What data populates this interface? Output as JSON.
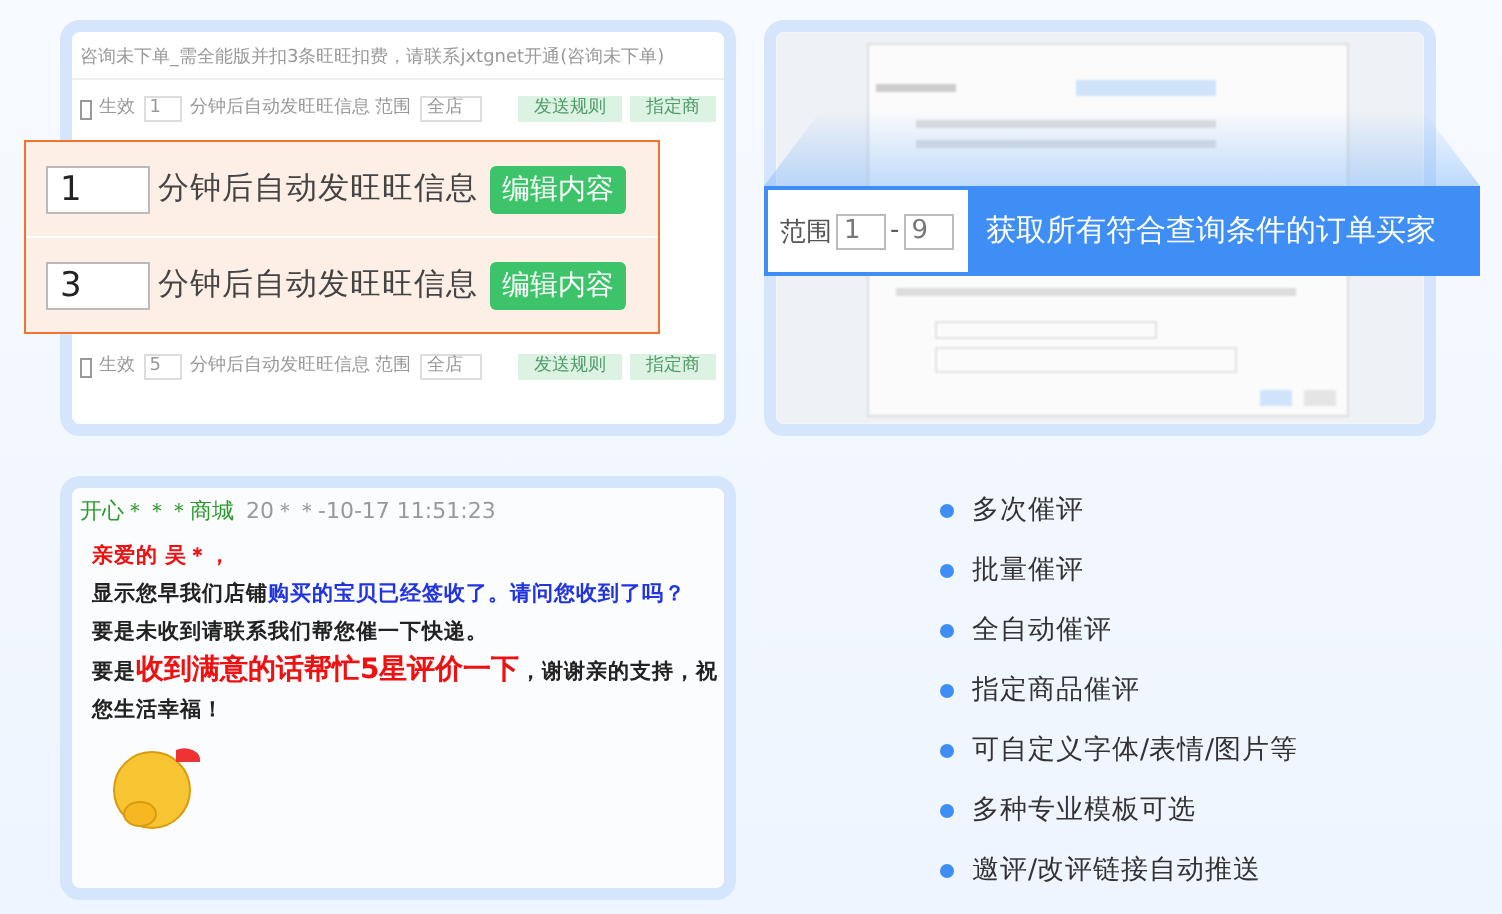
{
  "rule_panel": {
    "header": "咨询未下单_需全能版并扣3条旺旺扣费，请联系jxtgnet开通(咨询未下单)",
    "rows": [
      {
        "checked": false,
        "label": "生效",
        "minutes": "1",
        "text": "分钟后自动发旺旺信息 范围",
        "scope": "全店",
        "buttons": [
          "发送规则",
          "指定商"
        ]
      },
      {
        "checked": false,
        "label": "生效",
        "minutes": "5",
        "text": "分钟后自动发旺旺信息 范围",
        "scope": "全店",
        "buttons": [
          "发送规则",
          "指定商"
        ]
      }
    ]
  },
  "rule_zoom": {
    "rows": [
      {
        "minutes": "1",
        "text": "分钟后自动发旺旺信息",
        "button": "编辑内容"
      },
      {
        "minutes": "3",
        "text": "分钟后自动发旺旺信息",
        "button": "编辑内容"
      }
    ]
  },
  "range_banner": {
    "label": "范围",
    "from": "1",
    "separator": "-",
    "to": "9",
    "caption": "获取所有符合查询条件的订单买家"
  },
  "chat": {
    "sender": "开心＊＊＊商城",
    "time": "20＊＊-10-17 11:51:23",
    "lines": [
      [
        {
          "text": "亲爱的 吴＊，",
          "color": "#f01010",
          "large": false
        }
      ],
      [
        {
          "text": "显示您早我们店铺",
          "color": "#222222",
          "large": false
        },
        {
          "text": "购买的宝贝已经签收了。请问您收到了吗？",
          "color": "#2233e0",
          "large": false
        }
      ],
      [
        {
          "text": "要是未收到请联系我们帮您催一下快递。",
          "color": "#222222",
          "large": false
        }
      ],
      [
        {
          "text": "要是",
          "color": "#222222",
          "large": false
        },
        {
          "text": "收到满意的话帮忙5星评价一下",
          "color": "#f01010",
          "large": true
        },
        {
          "text": "，谢谢亲的支持，祝您生活幸福！",
          "color": "#222222",
          "large": false
        }
      ]
    ]
  },
  "features": [
    "多次催评",
    "批量催评",
    "全自动催评",
    "指定商品催评",
    "可自定义字体/表情/图片等",
    "多种专业模板可选",
    "邀评/改评链接自动推送"
  ]
}
